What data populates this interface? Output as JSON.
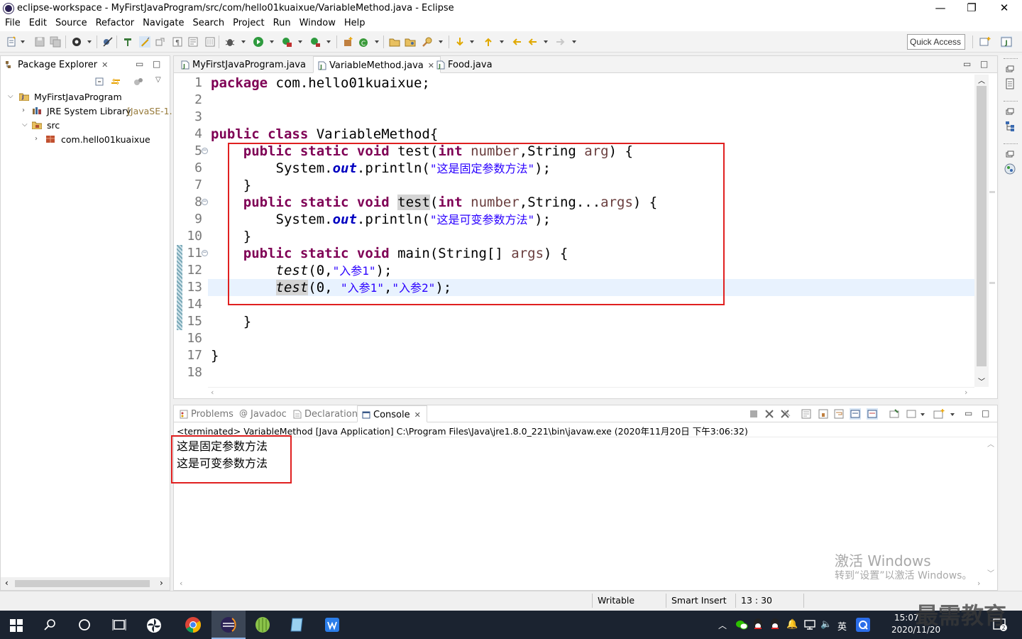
{
  "window": {
    "title": "eclipse-workspace - MyFirstJavaProgram/src/com/hello01kuaixue/VariableMethod.java - Eclipse",
    "minimize": "—",
    "restore": "❐",
    "close": "✕"
  },
  "menu": [
    "File",
    "Edit",
    "Source",
    "Refactor",
    "Navigate",
    "Search",
    "Project",
    "Run",
    "Window",
    "Help"
  ],
  "toolbar": {
    "quick_access": "Quick Access"
  },
  "package_explorer": {
    "title": "Package Explorer",
    "tree": [
      {
        "label": "MyFirstJavaProgram"
      },
      {
        "label": "JRE System Library",
        "decoration": "[JavaSE-1."
      },
      {
        "label": "src"
      },
      {
        "label": "com.hello01kuaixue"
      }
    ]
  },
  "editor": {
    "tabs": [
      {
        "label": "MyFirstJavaProgram.java"
      },
      {
        "label": "VariableMethod.java"
      },
      {
        "label": "Food.java"
      }
    ],
    "line_numbers": [
      "1",
      "2",
      "3",
      "4",
      "5",
      "6",
      "7",
      "8",
      "9",
      "10",
      "11",
      "12",
      "13",
      "14",
      "15",
      "16",
      "17",
      "18"
    ],
    "code": {
      "l1_kw": "package",
      "l1_rest": " com.hello01kuaixue;",
      "l4_kw": "public class",
      "l4_rest": " VariableMethod{",
      "l5_kw": "public static void",
      "l5_a": " test(",
      "l5_int": "int",
      "l5_b": " ",
      "l5_p1": "number",
      "l5_c": ",String ",
      "l5_p2": "arg",
      "l5_d": ") {",
      "l6_a": "System.",
      "l6_out": "out",
      "l6_b": ".println(",
      "l6_str": "\"这是固定参数方法\"",
      "l6_c": ");",
      "l7": "}",
      "l8_kw": "public static void",
      "l8_a": " ",
      "l8_test": "test",
      "l8_b": "(",
      "l8_int": "int",
      "l8_c": " ",
      "l8_p1": "number",
      "l8_d": ",String...",
      "l8_p2": "args",
      "l8_e": ") {",
      "l9_a": "System.",
      "l9_out": "out",
      "l9_b": ".println(",
      "l9_str": "\"这是可变参数方法\"",
      "l9_c": ");",
      "l10": "}",
      "l11_kw": "public static void",
      "l11_a": " main(String[] ",
      "l11_p": "args",
      "l11_b": ") {",
      "l12_test": "test",
      "l12_a": "(0,",
      "l12_str": "\"入参1\"",
      "l12_b": ");",
      "l13_test": "test",
      "l13_a": "(0, ",
      "l13_s1": "\"入参1\"",
      "l13_b": ",",
      "l13_s2": "\"入参2\"",
      "l13_c": ");",
      "l15": "}",
      "l17": "}"
    }
  },
  "console": {
    "tabs": [
      {
        "label": "Problems"
      },
      {
        "label": "Javadoc"
      },
      {
        "label": "Declaration"
      },
      {
        "label": "Console"
      }
    ],
    "header": "<terminated> VariableMethod [Java Application] C:\\Program Files\\Java\\jre1.8.0_221\\bin\\javaw.exe (2020年11月20日 下午3:06:32)",
    "output": [
      "这是固定参数方法",
      "这是可变参数方法"
    ]
  },
  "status": {
    "writable": "Writable",
    "insert_mode": "Smart Insert",
    "position": "13 : 30"
  },
  "watermark": {
    "line1": "激活 Windows",
    "line2": "转到“设置”以激活 Windows。"
  },
  "taskbar": {
    "time": "15:07",
    "date": "2020/11/20",
    "ime": "英",
    "logo_text": "最需教育"
  }
}
